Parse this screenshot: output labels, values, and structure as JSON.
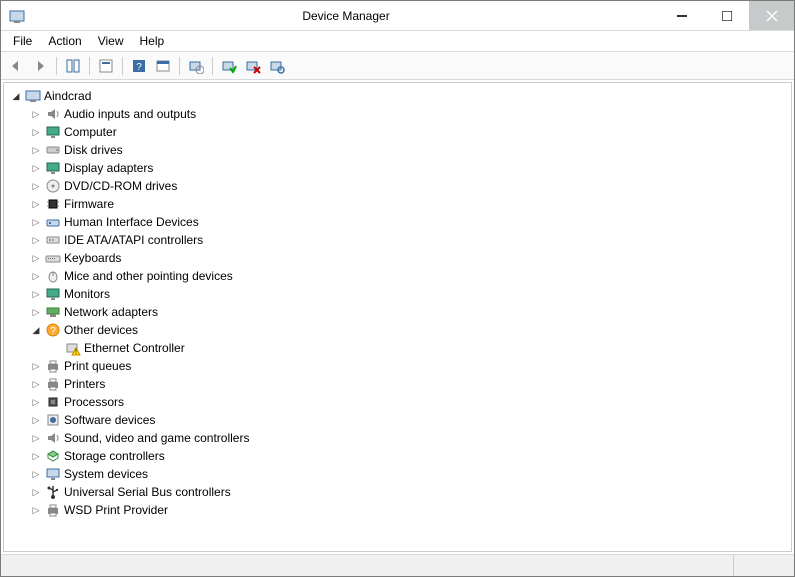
{
  "title": "Device Manager",
  "menu": [
    "File",
    "Action",
    "View",
    "Help"
  ],
  "root": {
    "label": "Aindcrad",
    "icon": "computer-icon",
    "expanded": true,
    "children": [
      {
        "label": "Audio inputs and outputs",
        "icon": "speaker-icon",
        "expanded": false,
        "children": []
      },
      {
        "label": "Computer",
        "icon": "monitor-icon",
        "expanded": false,
        "children": []
      },
      {
        "label": "Disk drives",
        "icon": "drive-icon",
        "expanded": false,
        "children": []
      },
      {
        "label": "Display adapters",
        "icon": "monitor-icon",
        "expanded": false,
        "children": []
      },
      {
        "label": "DVD/CD-ROM drives",
        "icon": "disc-icon",
        "expanded": false,
        "children": []
      },
      {
        "label": "Firmware",
        "icon": "chip-icon",
        "expanded": false,
        "children": []
      },
      {
        "label": "Human Interface Devices",
        "icon": "hid-icon",
        "expanded": false,
        "children": []
      },
      {
        "label": "IDE ATA/ATAPI controllers",
        "icon": "ata-icon",
        "expanded": false,
        "children": []
      },
      {
        "label": "Keyboards",
        "icon": "keyboard-icon",
        "expanded": false,
        "children": []
      },
      {
        "label": "Mice and other pointing devices",
        "icon": "mouse-icon",
        "expanded": false,
        "children": []
      },
      {
        "label": "Monitors",
        "icon": "monitor-icon",
        "expanded": false,
        "children": []
      },
      {
        "label": "Network adapters",
        "icon": "network-icon",
        "expanded": false,
        "children": []
      },
      {
        "label": "Other devices",
        "icon": "unknown-icon",
        "expanded": true,
        "children": [
          {
            "label": "Ethernet Controller",
            "icon": "warning-icon",
            "expanded": false,
            "children": null
          }
        ]
      },
      {
        "label": "Print queues",
        "icon": "printer-icon",
        "expanded": false,
        "children": []
      },
      {
        "label": "Printers",
        "icon": "printer-icon",
        "expanded": false,
        "children": []
      },
      {
        "label": "Processors",
        "icon": "cpu-icon",
        "expanded": false,
        "children": []
      },
      {
        "label": "Software devices",
        "icon": "software-icon",
        "expanded": false,
        "children": []
      },
      {
        "label": "Sound, video and game controllers",
        "icon": "speaker-icon",
        "expanded": false,
        "children": []
      },
      {
        "label": "Storage controllers",
        "icon": "storage-icon",
        "expanded": false,
        "children": []
      },
      {
        "label": "System devices",
        "icon": "system-icon",
        "expanded": false,
        "children": []
      },
      {
        "label": "Universal Serial Bus controllers",
        "icon": "usb-icon",
        "expanded": false,
        "children": []
      },
      {
        "label": "WSD Print Provider",
        "icon": "printer-icon",
        "expanded": false,
        "children": []
      }
    ]
  }
}
